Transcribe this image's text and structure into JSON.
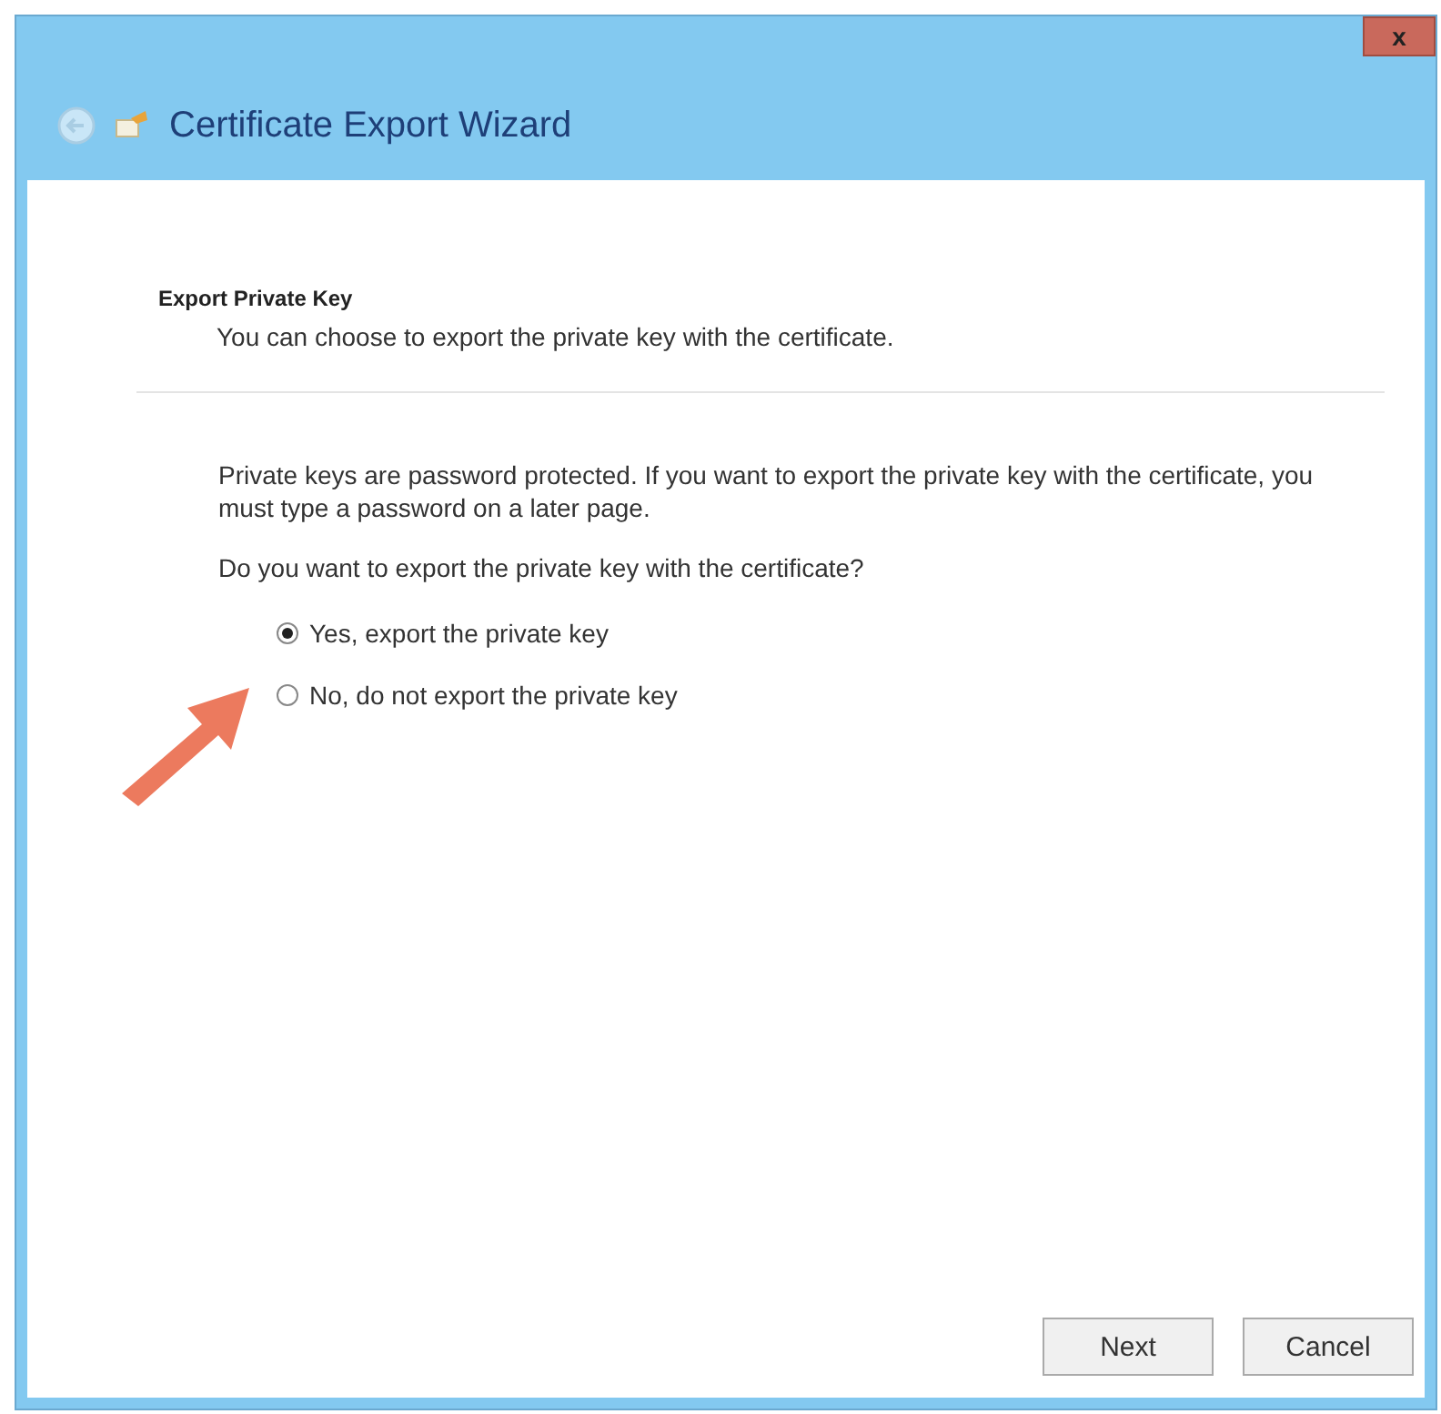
{
  "window": {
    "title": "Certificate Export Wizard",
    "close_label": "x"
  },
  "page": {
    "heading": "Export Private Key",
    "subtitle": "You can choose to export the private key with the certificate."
  },
  "body": {
    "paragraph": "Private keys are password protected. If you want to export the private key with the certificate, you must type a password on a later page.",
    "question": "Do you want to export the private key with the certificate?"
  },
  "options": [
    {
      "label": "Yes, export the private key",
      "selected": true
    },
    {
      "label": "No, do not export the private key",
      "selected": false
    }
  ],
  "buttons": [
    {
      "label": "Next"
    },
    {
      "label": "Cancel"
    }
  ]
}
